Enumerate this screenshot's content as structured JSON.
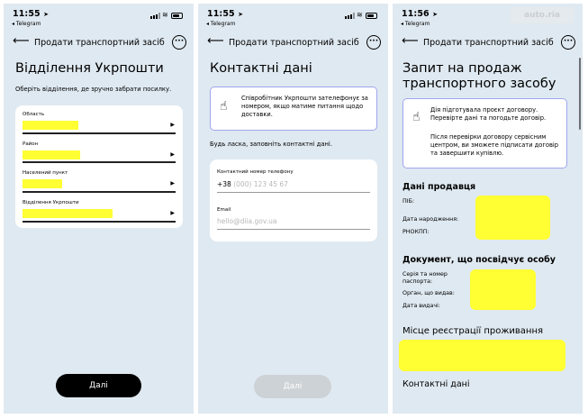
{
  "screens": [
    {
      "status": {
        "time": "11:55",
        "back_app": "◂ Telegram"
      },
      "topbar": {
        "title": "Продати транспортний засіб",
        "back_icon": "arrow-left-icon",
        "more_icon": "more-icon"
      },
      "title": "Відділення Укрпошти",
      "subtitle": "Оберіть відділення, де зручно забрати посилку.",
      "fields": [
        {
          "label": "Область"
        },
        {
          "label": "Район"
        },
        {
          "label": "Населений пункт"
        },
        {
          "label": "Відділення Укрпошти"
        }
      ],
      "button": "Далі"
    },
    {
      "status": {
        "time": "11:55",
        "back_app": "◂ Telegram"
      },
      "topbar": {
        "title": "Продати транспортний засіб",
        "back_icon": "arrow-left-icon",
        "more_icon": "more-icon"
      },
      "title": "Контактні дані",
      "notice": "Співробітник Укрпошти зателефонує за номером, якщо матиме питання щодо доставки.",
      "instruction": "Будь ласка, заповніть контактні дані.",
      "phone": {
        "label": "Контактний номер телефону",
        "prefix": "+38",
        "placeholder": "(000) 123 45 67"
      },
      "email": {
        "label": "Email",
        "placeholder": "hello@diia.gov.ua"
      },
      "button": "Далі"
    },
    {
      "status": {
        "time": "11:56",
        "back_app": "◂ Telegram"
      },
      "logo": "auto.ria",
      "topbar": {
        "title": "Продати транспортний засіб",
        "back_icon": "arrow-left-icon",
        "more_icon": "more-icon"
      },
      "title_line1": "Запит на продаж",
      "title_line2": "транспортного засобу",
      "notice_p1": "Дія підготувала проєкт договору. Перевірте дані та погодьте договір.",
      "notice_p2": "Після перевірки договору сервісним центром, ви зможете підписати договір та завершити купівлю.",
      "seller": {
        "heading": "Дані продавця",
        "name": "ПІБ:",
        "birth": "Дата народження:",
        "rnokpp": "РНОКПП:"
      },
      "document": {
        "heading": "Документ, що посвідчує особу",
        "series": "Серія та номер паспорта:",
        "issuer": "Орган, що видав:",
        "date": "Дата видачі:"
      },
      "residence": {
        "heading": "Місце реєстрації проживання"
      },
      "contacts": {
        "heading": "Контактні дані"
      }
    }
  ],
  "colors": {
    "background": "#dfe9f1",
    "card": "#ffffff",
    "highlight": "#ffff33",
    "primary": "#000000",
    "disabled": "#cdd2d6",
    "notice_border": "#9fa6ee"
  }
}
